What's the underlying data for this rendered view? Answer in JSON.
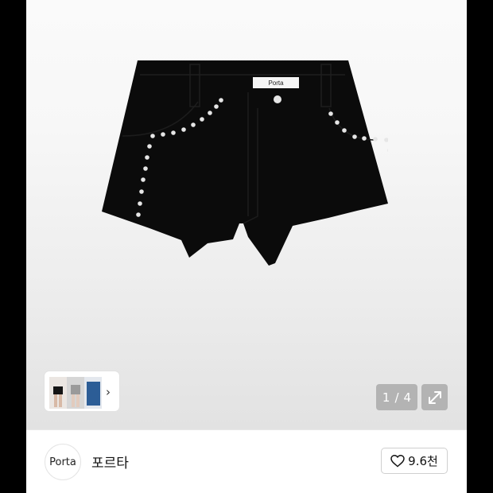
{
  "gallery": {
    "label_on_waistband": "Porta",
    "current_page": "1",
    "separator": "/",
    "total_pages": "4",
    "thumb_chevron": "›",
    "expand_icon": "expand-icon"
  },
  "brand": {
    "logo_text": "Porta",
    "name": "포르타"
  },
  "like": {
    "icon": "heart-icon",
    "count": "9.6천"
  },
  "colors": {
    "shorts": "#0b0b0b",
    "stud": "#e6e6e6",
    "counter_bg": "#b3b3b3"
  }
}
